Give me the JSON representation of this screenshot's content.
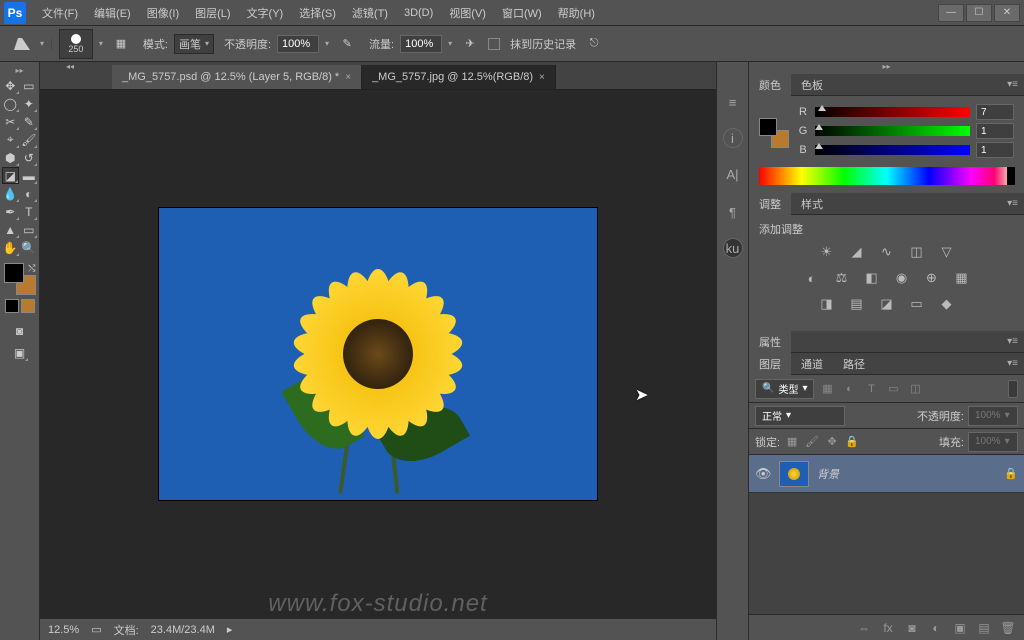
{
  "app_logo": "Ps",
  "menu": {
    "file": "文件(F)",
    "edit": "编辑(E)",
    "image": "图像(I)",
    "layer": "图层(L)",
    "type": "文字(Y)",
    "select": "选择(S)",
    "filter": "滤镜(T)",
    "threeD": "3D(D)",
    "view": "视图(V)",
    "window": "窗口(W)",
    "help": "帮助(H)"
  },
  "options": {
    "brush_size": "250",
    "mode_label": "模式:",
    "mode_value": "画笔",
    "opacity_label": "不透明度:",
    "opacity_value": "100%",
    "flow_label": "流量:",
    "flow_value": "100%",
    "erase_history": "抹到历史记录"
  },
  "tabs": [
    {
      "title": "_MG_5757.psd @ 12.5% (Layer 5, RGB/8) *"
    },
    {
      "title": "_MG_5757.jpg @ 12.5%(RGB/8)"
    }
  ],
  "status": {
    "zoom": "12.5%",
    "doc_label": "文档:",
    "doc_size": "23.4M/23.4M"
  },
  "watermark": "www.fox-studio.net",
  "panel_color": {
    "tab_color": "颜色",
    "tab_swatch": "色板",
    "r_label": "R",
    "r_value": "7",
    "g_label": "G",
    "g_value": "1",
    "b_label": "B",
    "b_value": "1"
  },
  "panel_adjust": {
    "tab_adjust": "调整",
    "tab_style": "样式",
    "title": "添加调整"
  },
  "panel_props": {
    "tab": "属性"
  },
  "panel_layers": {
    "tab_layer": "图层",
    "tab_channel": "通道",
    "tab_path": "路径",
    "filter_kind": "类型",
    "blend_mode": "正常",
    "opacity_label": "不透明度:",
    "opacity_value": "100%",
    "lock_label": "锁定:",
    "fill_label": "填充:",
    "fill_value": "100%",
    "layer_name": "背景"
  },
  "colors": {
    "fg": "#000000",
    "bg": "#b77a2e"
  },
  "chart_data": null
}
